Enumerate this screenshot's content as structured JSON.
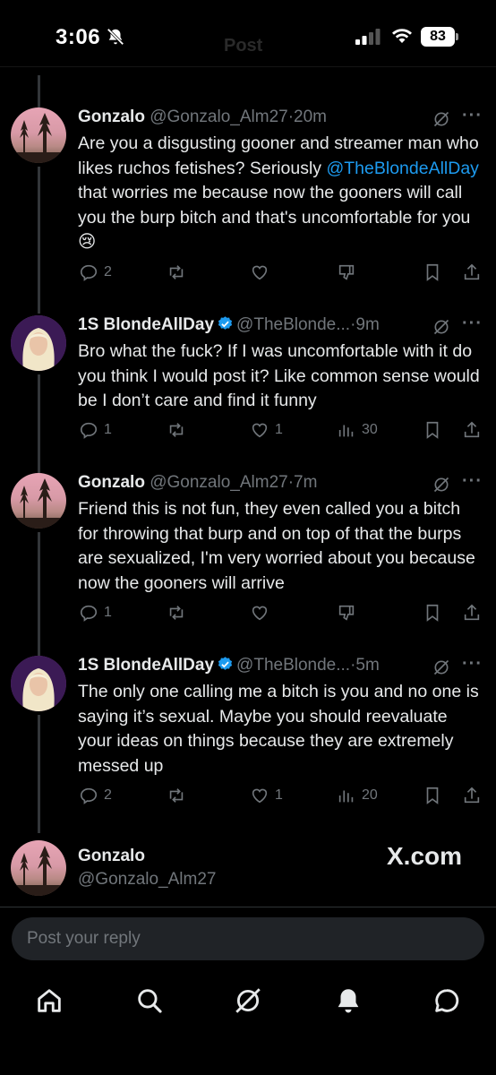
{
  "status_bar": {
    "time": "3:06",
    "battery": "83",
    "ghost_title": "Post"
  },
  "tweets": [
    {
      "name": "Gonzalo",
      "handle": "@Gonzalo_Alm27",
      "sep": "·",
      "time": "20m",
      "verified": false,
      "body_before": "Are you a disgusting gooner and streamer man who likes ruchos fetishes? Seriously ",
      "mention": "@TheBlondeAllDay",
      "body_after": " that worries me because now the gooners will call you the burp bitch and that's uncomfortable for you 😢",
      "replies": "2",
      "reposts": "",
      "likes": "",
      "views": "",
      "fourth_icon": "downvote-icon"
    },
    {
      "name": "1S BlondeAllDay",
      "handle": "@TheBlonde...",
      "sep": "·",
      "time": "9m",
      "verified": true,
      "body_before": "Bro what the fuck? If I was uncomfortable with it do you think I would post it? Like common sense would be I don’t care and find it funny",
      "mention": "",
      "body_after": "",
      "replies": "1",
      "reposts": "",
      "likes": "1",
      "views": "30",
      "fourth_icon": "views-icon"
    },
    {
      "name": "Gonzalo",
      "handle": "@Gonzalo_Alm27",
      "sep": "·",
      "time": "7m",
      "verified": false,
      "body_before": "Friend this is not fun, they even called you a bitch for throwing that burp and on top of that the burps are sexualized, I'm very worried about you because now the gooners will arrive",
      "mention": "",
      "body_after": "",
      "replies": "1",
      "reposts": "",
      "likes": "",
      "views": "",
      "fourth_icon": "downvote-icon"
    },
    {
      "name": "1S BlondeAllDay",
      "handle": "@TheBlonde...",
      "sep": "·",
      "time": "5m",
      "verified": true,
      "body_before": "The only one calling me a bitch is you and no one  is saying it’s sexual. Maybe you should reevaluate your ideas on things because they are extremely messed up",
      "mention": "",
      "body_after": "",
      "replies": "2",
      "reposts": "",
      "likes": "1",
      "views": "20",
      "fourth_icon": "views-icon"
    }
  ],
  "reply_context": {
    "name": "Gonzalo",
    "handle": "@Gonzalo_Alm27",
    "watermark": "X.com"
  },
  "reply_box": {
    "placeholder": "Post your reply"
  },
  "tab_bar": {
    "items": [
      "home-icon",
      "search-icon",
      "grok-icon",
      "notifications-icon",
      "messages-icon"
    ]
  },
  "colors": {
    "background": "#000000",
    "text": "#e7e9ea",
    "muted": "#71767b",
    "accent": "#1d9bf0"
  }
}
